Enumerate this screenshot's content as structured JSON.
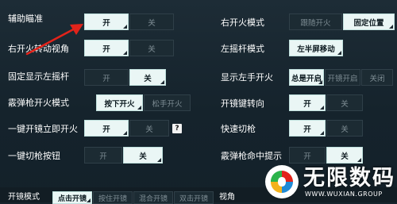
{
  "left_settings": [
    {
      "label": "辅助瞄准",
      "options": [
        "开",
        "关"
      ],
      "selected": 0
    },
    {
      "label": "右开火转动视角",
      "options": [
        "开",
        "关"
      ],
      "selected": 0
    },
    {
      "label": "固定显示左摇杆",
      "options": [
        "开",
        "关"
      ],
      "selected": 1
    },
    {
      "label": "霰弹枪开火模式",
      "options": [
        "按下开火",
        "松手开火"
      ],
      "selected": 0
    },
    {
      "label": "一键开镜立即开火",
      "options": [
        "开",
        "关"
      ],
      "selected": 0,
      "help": "?"
    },
    {
      "label": "一键切枪按钮",
      "options": [
        "开",
        "关"
      ],
      "selected": 1
    }
  ],
  "right_settings": [
    {
      "label": "右开火模式",
      "options": [
        "跟随开火",
        "固定位置"
      ],
      "selected": 1
    },
    {
      "label": "左摇杆模式",
      "options": [
        "左半屏移动"
      ],
      "selected": 0
    },
    {
      "label": "显示左手开火",
      "options": [
        "总是开启",
        "开镜开启",
        "关闭"
      ],
      "selected": 0
    },
    {
      "label": "开镜键转向",
      "options": [
        "开",
        "关"
      ],
      "selected": 0
    },
    {
      "label": "快速切枪",
      "options": [
        "开",
        "关"
      ],
      "selected": 0
    },
    {
      "label": "霰弹枪命中提示",
      "options": [
        "开",
        "关"
      ],
      "selected": 1
    }
  ],
  "bottom": {
    "label": "开镜模式",
    "options": [
      "点击开镜",
      "按住开镜",
      "混合开镜",
      "双击开镜"
    ],
    "selected": 0,
    "right_label": "视角"
  },
  "watermark": {
    "title": "无限数码",
    "url": "WWW.WUXIAN.GROUP"
  },
  "colors": {
    "selected_bg": "#eaf6f5",
    "unselected_bg": "#1c2b33",
    "background": "#17242d",
    "arrow": "#e2231a"
  }
}
